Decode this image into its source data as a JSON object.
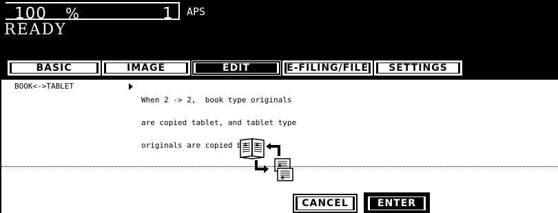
{
  "status": {
    "zoom_value": "100",
    "zoom_unit": "%",
    "copies": "1",
    "paper_mode": "APS",
    "machine_state": "READY"
  },
  "tabs": [
    {
      "label": "BASIC",
      "active": false
    },
    {
      "label": "IMAGE",
      "active": false
    },
    {
      "label": "EDIT",
      "active": true
    },
    {
      "label": "E-FILING/FILE",
      "active": false
    },
    {
      "label": "SETTINGS",
      "active": false
    }
  ],
  "function": {
    "name": "BOOK<->TABLET",
    "description_lines": [
      "When 2 -> 2,  book type originals",
      "are copied tablet, and tablet type",
      "originals are copied book."
    ]
  },
  "illustration": {
    "icon": "book-to-tablet-icon",
    "text_marks": [
      "A",
      "B"
    ]
  },
  "buttons": {
    "cancel_label": "CANCEL",
    "enter_label": "ENTER"
  }
}
